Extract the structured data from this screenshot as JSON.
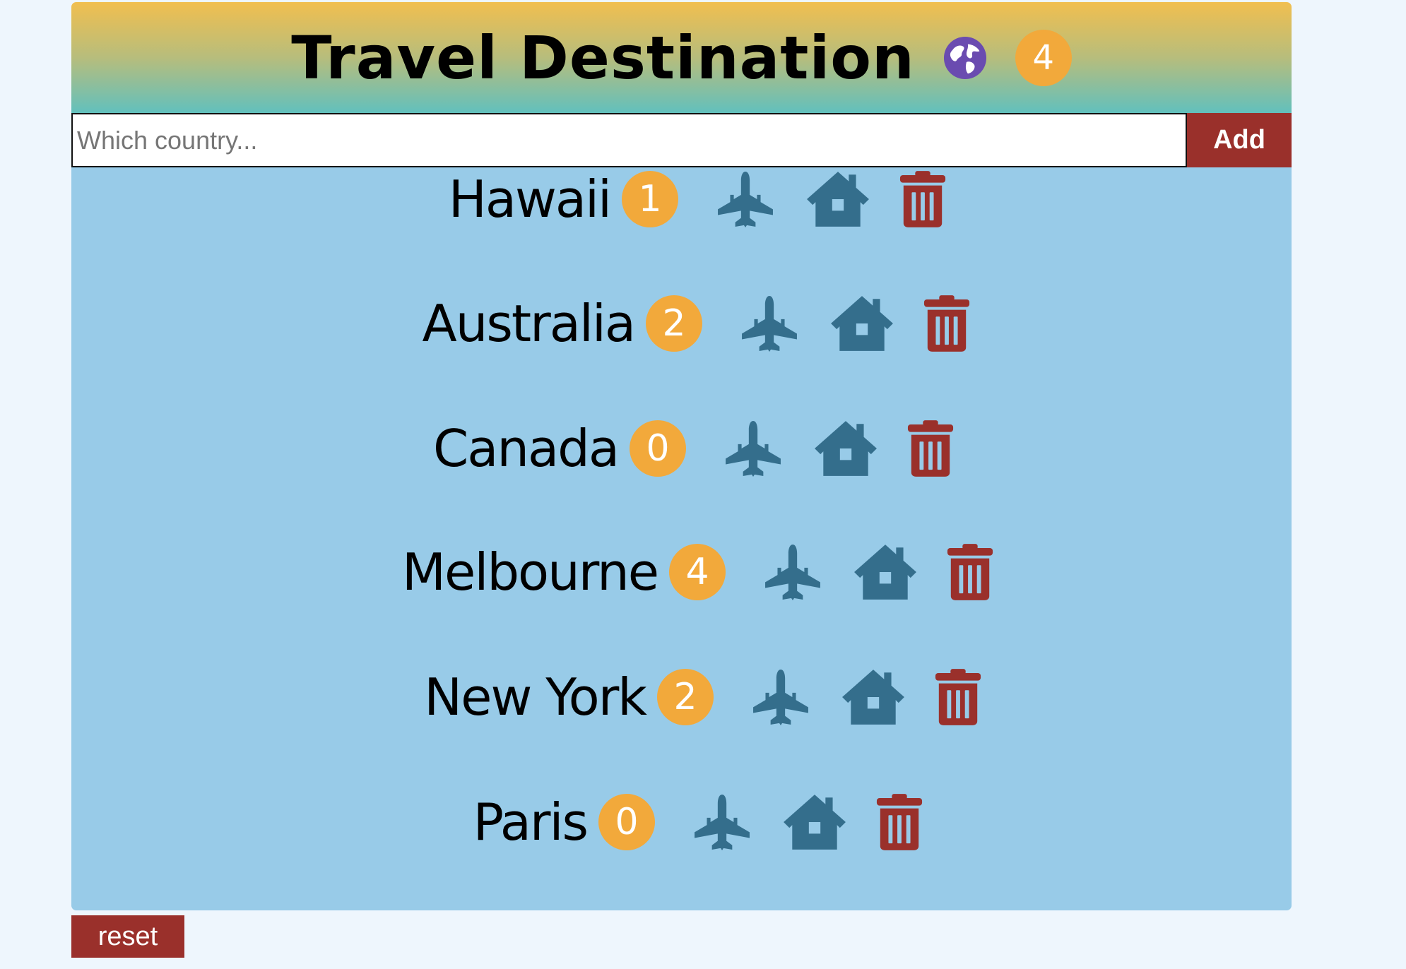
{
  "header": {
    "title": "Travel Destination",
    "globe_icon": "globe-icon",
    "total_count": "4"
  },
  "add_form": {
    "placeholder": "Which country...",
    "value": "",
    "add_label": "Add"
  },
  "destinations": [
    {
      "name": "Hawaii",
      "count": "1"
    },
    {
      "name": "Australia",
      "count": "2"
    },
    {
      "name": "Canada",
      "count": "0"
    },
    {
      "name": "Melbourne",
      "count": "4"
    },
    {
      "name": "New York",
      "count": "2"
    },
    {
      "name": "Paris",
      "count": "0"
    }
  ],
  "row_icons": [
    "plane-icon",
    "home-icon",
    "trash-icon"
  ],
  "reset_label": "reset",
  "colors": {
    "badge": "#f2a93b",
    "icon": "#346e8c",
    "delete": "#9a302b",
    "list_background": "#98cbe8",
    "header_top": "#f1bf4f",
    "header_bottom": "#62c0bd"
  }
}
